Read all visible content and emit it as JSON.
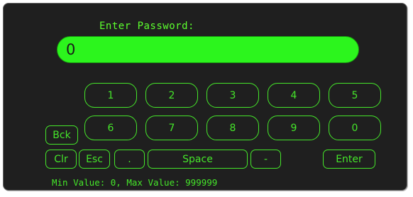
{
  "dialog": {
    "title": "Enter Password:",
    "value": "0",
    "range_text": "Min Value: 0, Max Value: 999999"
  },
  "keys": {
    "k1": "1",
    "k2": "2",
    "k3": "3",
    "k4": "4",
    "k5": "5",
    "k6": "6",
    "k7": "7",
    "k8": "8",
    "k9": "9",
    "k0": "0",
    "back": "Bck",
    "clear": "Clr",
    "escape": "Esc",
    "dot": ".",
    "space": "Space",
    "minus": "-",
    "enter": "Enter"
  },
  "colors": {
    "accent": "#45e62a",
    "display_fill": "#2cf51d",
    "background": "#1f1f1f"
  }
}
